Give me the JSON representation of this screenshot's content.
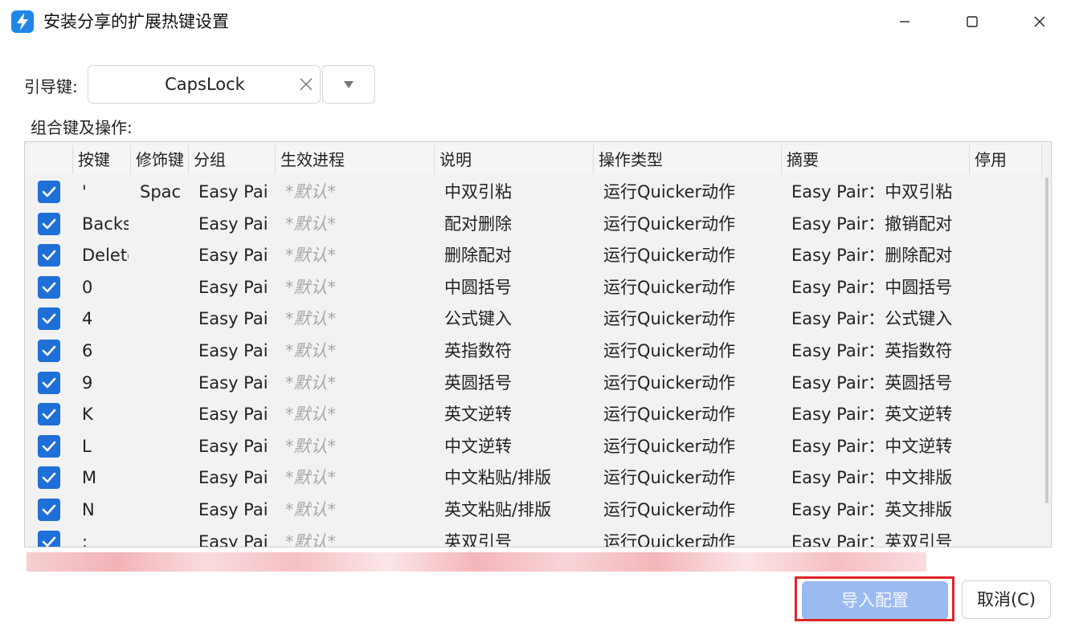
{
  "window": {
    "title": "安装分享的扩展热键设置",
    "icon": "quicker-bolt-icon"
  },
  "leader": {
    "label": "引导键:",
    "value": "CapsLock"
  },
  "combo_label": "组合键及操作:",
  "columns": [
    "按键",
    "修饰键",
    "分组",
    "生效进程",
    "说明",
    "操作类型",
    "摘要",
    "停用"
  ],
  "rows": [
    {
      "checked": true,
      "key": "'",
      "mod": "Space",
      "group": "Easy Pair",
      "process": "*默认*",
      "desc": "中双引粘",
      "type": "运行Quicker动作",
      "summary": "Easy Pair：中双引粘"
    },
    {
      "checked": true,
      "key": "Backspace",
      "mod": "",
      "group": "Easy Pair",
      "process": "*默认*",
      "desc": "配对删除",
      "type": "运行Quicker动作",
      "summary": "Easy Pair：撤销配对"
    },
    {
      "checked": true,
      "key": "Delete",
      "mod": "",
      "group": "Easy Pair",
      "process": "*默认*",
      "desc": "删除配对",
      "type": "运行Quicker动作",
      "summary": "Easy Pair：删除配对"
    },
    {
      "checked": true,
      "key": "0",
      "mod": "",
      "group": "Easy Pair",
      "process": "*默认*",
      "desc": "中圆括号",
      "type": "运行Quicker动作",
      "summary": "Easy Pair：中圆括号"
    },
    {
      "checked": true,
      "key": "4",
      "mod": "",
      "group": "Easy Pair",
      "process": "*默认*",
      "desc": "公式键入",
      "type": "运行Quicker动作",
      "summary": "Easy Pair：公式键入"
    },
    {
      "checked": true,
      "key": "6",
      "mod": "",
      "group": "Easy Pair",
      "process": "*默认*",
      "desc": "英指数符",
      "type": "运行Quicker动作",
      "summary": "Easy Pair：英指数符"
    },
    {
      "checked": true,
      "key": "9",
      "mod": "",
      "group": "Easy Pair",
      "process": "*默认*",
      "desc": "英圆括号",
      "type": "运行Quicker动作",
      "summary": "Easy Pair：英圆括号"
    },
    {
      "checked": true,
      "key": "K",
      "mod": "",
      "group": "Easy Pair",
      "process": "*默认*",
      "desc": "英文逆转",
      "type": "运行Quicker动作",
      "summary": "Easy Pair：英文逆转"
    },
    {
      "checked": true,
      "key": "L",
      "mod": "",
      "group": "Easy Pair",
      "process": "*默认*",
      "desc": "中文逆转",
      "type": "运行Quicker动作",
      "summary": "Easy Pair：中文逆转"
    },
    {
      "checked": true,
      "key": "M",
      "mod": "",
      "group": "Easy Pair",
      "process": "*默认*",
      "desc": "中文粘贴/排版",
      "type": "运行Quicker动作",
      "summary": "Easy Pair：中文排版"
    },
    {
      "checked": true,
      "key": "N",
      "mod": "",
      "group": "Easy Pair",
      "process": "*默认*",
      "desc": "英文粘贴/排版",
      "type": "运行Quicker动作",
      "summary": "Easy Pair：英文排版"
    },
    {
      "checked": true,
      "key": ";",
      "mod": "",
      "group": "Easy Pair",
      "process": "*默认*",
      "desc": "英双引号",
      "type": "运行Quicker动作",
      "summary": "Easy Pair：英双引号"
    }
  ],
  "buttons": {
    "import": "导入配置",
    "cancel": "取消(C)"
  }
}
